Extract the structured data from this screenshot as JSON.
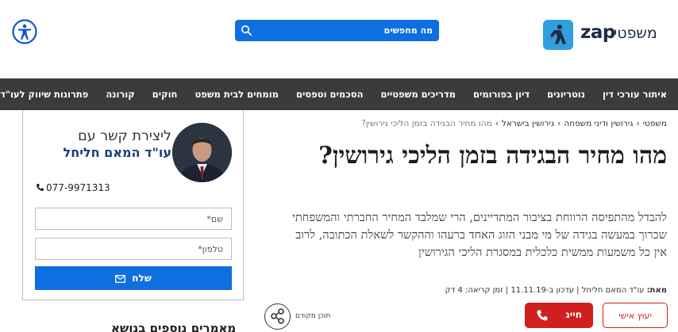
{
  "brand": {
    "logo_text": "zap",
    "logo_sub": "משפטי",
    "accent": "#0f6fe0",
    "logo_color": "#2f9fe0"
  },
  "search": {
    "placeholder": "מה מחפשים"
  },
  "accessibility": {
    "icon": "accessibility-icon"
  },
  "nav": {
    "items": [
      "איתור עורכי דין",
      "נוטריונים",
      "דיון בפורומים",
      "מדריכים משפטיים",
      "הסכמים וטפסים",
      "מומחים לבית משפט",
      "חוקים",
      "קורונה",
      "פתרונות שיווק לעו\"ד"
    ]
  },
  "breadcrumb": {
    "items": [
      "משפטי",
      "גירושין ודיני משפחה",
      "גירושין בישראל"
    ],
    "current": "מהו מחיר הבגידה בזמן הליכי גירושין?",
    "separator": "›"
  },
  "article": {
    "title": "מהו מחיר הבגידה בזמן הליכי גירושין?",
    "lead": "להבדל מהתפיסה הרווחת בציבור המתדיינים, הרי שמלבד המחיר החברתי והמשפחתי שכרוך במעשה בגידה של מי מבני הזוג האחד ברעהו וההקשר לשאלת הכתובה, לרוב אין כל משמעות ממשית כלכלית במסגרת הליכי הגירושין",
    "meta": {
      "author_label": "מאת:",
      "author": "עו\"ד המאם חליחל",
      "updated": "עדכון ב-11.11.19",
      "read_time": "זמן קריאה: 4 דק"
    }
  },
  "actions": {
    "advice_label": "יעוץ אישי",
    "call_label": "חייג",
    "share_label": "תוכן מקודם",
    "danger": "#d01f1f"
  },
  "contact": {
    "title": "ליצירת קשר עם",
    "name": "עו\"ד המאם חליחל",
    "phone": "077-9971313",
    "name_placeholder": "שם*",
    "phone_placeholder": "טלפון*",
    "send_label": "שלח"
  },
  "sidebar_more": {
    "heading": "מאמרים נוספים בנושא"
  }
}
